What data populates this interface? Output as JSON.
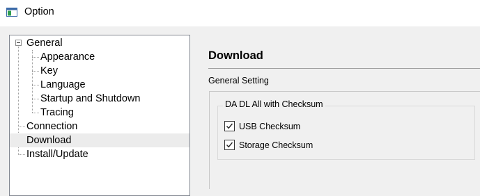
{
  "window": {
    "title": "Option",
    "icon": "app-window-icon"
  },
  "tree": {
    "items": [
      {
        "label": "General",
        "expanded": true,
        "level": 0
      },
      {
        "label": "Appearance",
        "level": 1
      },
      {
        "label": "Key",
        "level": 1
      },
      {
        "label": "Language",
        "level": 1
      },
      {
        "label": "Startup and Shutdown",
        "level": 1
      },
      {
        "label": "Tracing",
        "level": 1
      },
      {
        "label": "Connection",
        "level": 0
      },
      {
        "label": "Download",
        "level": 0,
        "selected": true
      },
      {
        "label": "Install/Update",
        "level": 0
      }
    ]
  },
  "content": {
    "title": "Download",
    "section_label": "General Setting",
    "group": {
      "label": "DA DL All with Checksum",
      "checkboxes": [
        {
          "label": "USB Checksum",
          "checked": true
        },
        {
          "label": "Storage Checksum",
          "checked": true
        }
      ]
    }
  }
}
